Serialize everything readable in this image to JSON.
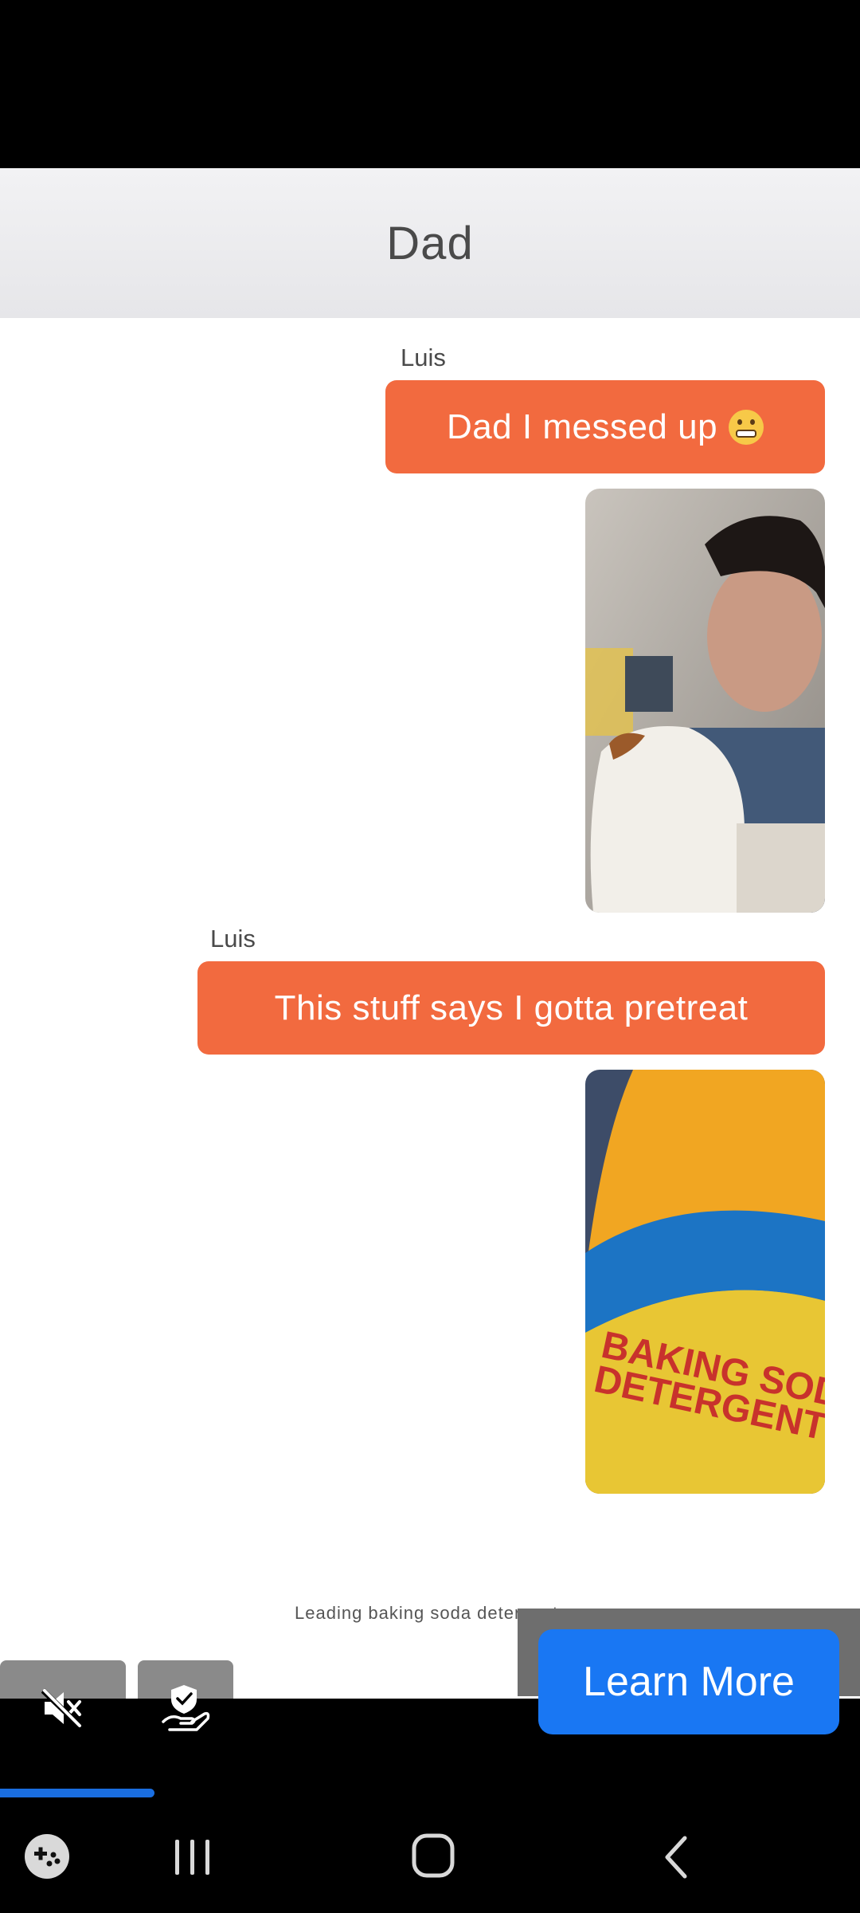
{
  "header": {
    "title": "Dad"
  },
  "messages": [
    {
      "sender": "Luis",
      "text": "Dad I messed up",
      "emoji": "grimacing-face-emoji"
    },
    {
      "type": "photo",
      "description_icon": "photo-man-holding-stained-shirt"
    },
    {
      "sender": "Luis",
      "text": "This stuff says I gotta pretreat"
    },
    {
      "type": "photo",
      "label": "BAKING SODA DETERGENT"
    }
  ],
  "ad": {
    "caption": "Leading baking soda detergent",
    "cta_label": "Learn More",
    "progress": 0.18,
    "icons": [
      "mute-icon",
      "ad-choices-shield-icon"
    ]
  },
  "nav": {
    "icons": [
      "game-launcher-icon",
      "recent-apps-icon",
      "home-icon",
      "back-icon"
    ]
  },
  "colors": {
    "bubble": "#f26a3f",
    "cta": "#1977f3",
    "progress": "#1a6ee0"
  }
}
